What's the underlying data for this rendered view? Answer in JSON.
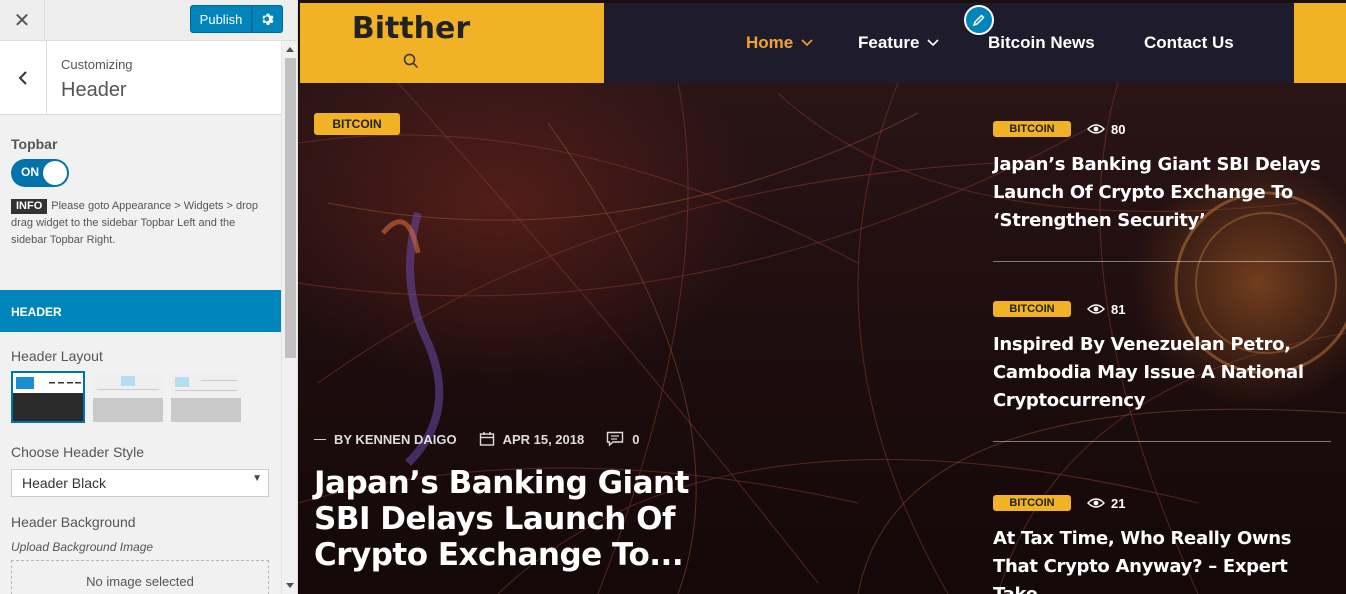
{
  "customizer": {
    "close_icon": "close-icon",
    "publish_label": "Publish",
    "settings_icon": "gear-icon",
    "breadcrumb": "Customizing",
    "title": "Header",
    "topbar": {
      "label": "Topbar",
      "toggle_label": "ON",
      "toggle_state": true,
      "info_tag": "INFO",
      "info_text": "Please goto Appearance > Widgets > drop drag widget to the sidebar Topbar Left and the sidebar Topbar Right."
    },
    "section_label": "HEADER",
    "header_layout_label": "Header Layout",
    "header_layout_selected": 1,
    "choose_style_label": "Choose Header Style",
    "style_value": "Header Black",
    "background_label": "Header Background",
    "upload_label": "Upload Background Image",
    "no_image_label": "No image selected"
  },
  "site": {
    "logo": "Bitther",
    "nav": [
      {
        "label": "Home",
        "active": true,
        "has_dropdown": true
      },
      {
        "label": "Feature",
        "active": false,
        "has_dropdown": true
      },
      {
        "label": "Bitcoin News",
        "active": false,
        "has_dropdown": false
      },
      {
        "label": "Contact Us",
        "active": false,
        "has_dropdown": false
      }
    ],
    "hero": {
      "category": "BITCOIN",
      "author": "BY KENNEN DAIGO",
      "date": "APR 15, 2018",
      "comments": "0",
      "title": "Japan’s Banking Giant SBI Delays Launch Of Crypto Exchange To..."
    },
    "side_posts": [
      {
        "category": "BITCOIN",
        "views": "80",
        "title": "Japan’s Banking Giant SBI Delays Launch Of Crypto Exchange To ‘Strengthen Security’"
      },
      {
        "category": "BITCOIN",
        "views": "81",
        "title": "Inspired By Venezuelan Petro, Cambodia May Issue A National Cryptocurrency"
      },
      {
        "category": "BITCOIN",
        "views": "21",
        "title": "At Tax Time, Who Really Owns That Crypto Anyway? – Expert Take"
      }
    ],
    "colors": {
      "accent": "#f2b225",
      "nav_bg": "#1e1c2c",
      "wp_blue": "#0085ba"
    }
  }
}
